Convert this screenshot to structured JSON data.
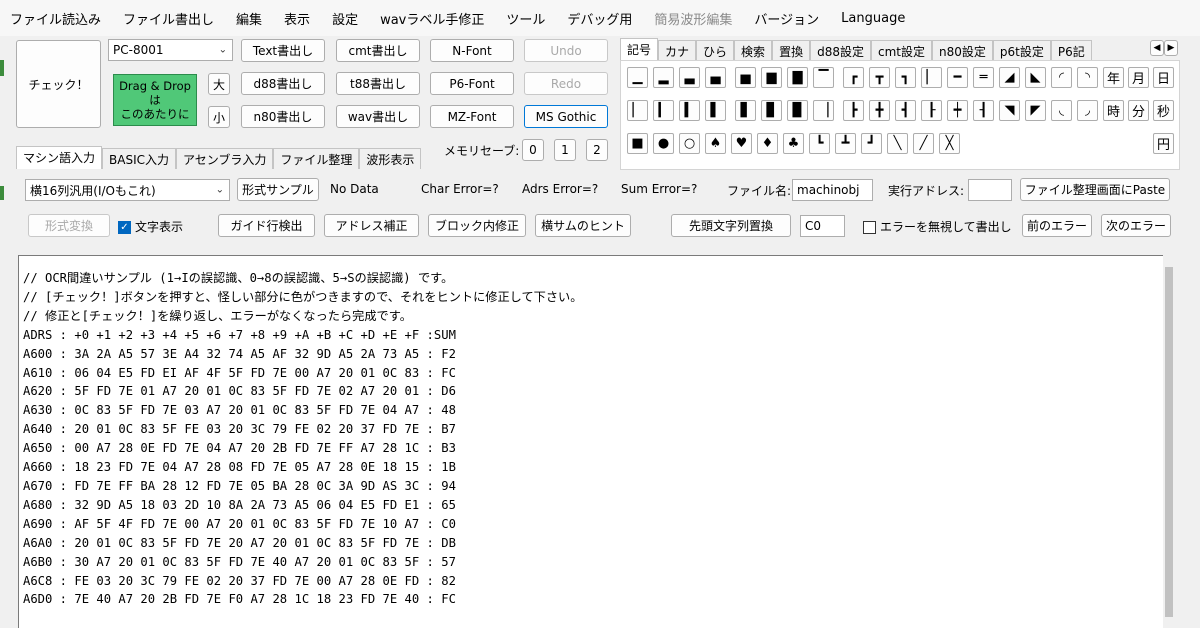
{
  "menu": [
    "ファイル読込み",
    "ファイル書出し",
    "編集",
    "表示",
    "設定",
    "wavラベル手修正",
    "ツール",
    "デバッグ用",
    "簡易波形編集",
    "バージョン",
    "Language"
  ],
  "menu_disabled": [
    false,
    false,
    false,
    false,
    false,
    false,
    false,
    false,
    true,
    false,
    false
  ],
  "check_button": "チェック！",
  "machine_select": "PC-8001",
  "drag_drop": [
    "Drag & Drop",
    "は",
    "このあたりに"
  ],
  "size_large": "大",
  "size_small": "小",
  "buttons": {
    "text_export": "Text書出し",
    "cmt_export": "cmt書出し",
    "d88_export": "d88書出し",
    "t88_export": "t88書出し",
    "n80_export": "n80書出し",
    "wav_export": "wav書出し",
    "nfont": "N-Font",
    "p6font": "P6-Font",
    "mzfont": "MZ-Font",
    "msgothic": "MS Gothic",
    "undo": "Undo",
    "redo": "Redo"
  },
  "memory_save": {
    "label": "メモリセーブ:",
    "slots": [
      "0",
      "1",
      "2"
    ]
  },
  "symbol_tabs": [
    "記号",
    "カナ",
    "ひら",
    "検索",
    "置換",
    "d88設定",
    "cmt設定",
    "n80設定",
    "p6t設定",
    "P6記"
  ],
  "symbols_row1": [
    "▁",
    "▂",
    "▃",
    "▄",
    "▅",
    "▆",
    "▇",
    "▔",
    "┏",
    "┳",
    "┓",
    "▏",
    "━",
    "═",
    "◢",
    "◣",
    "◜",
    "◝"
  ],
  "symbols_row2": [
    "▏",
    "▎",
    "▍",
    "▌",
    "▋",
    "▊",
    "▉",
    "▕",
    "┣",
    "╋",
    "┫",
    "┠",
    "┿",
    "┨",
    "◥",
    "◤",
    "◟",
    "◞"
  ],
  "symbols_row3": [
    "■",
    "●",
    "○",
    "♠",
    "♥",
    "♦",
    "♣",
    "┗",
    "┻",
    "┛",
    "╲",
    "╱",
    "╳"
  ],
  "date_buttons": [
    "年",
    "月",
    "日",
    "時",
    "分",
    "秒",
    "円"
  ],
  "input_tabs": [
    "マシン語入力",
    "BASIC入力",
    "アセンブラ入力",
    "ファイル整理",
    "波形表示"
  ],
  "format_select": "横16列汎用(I/Oもこれ)",
  "format_sample": "形式サンプル",
  "status": {
    "data": "No Data",
    "char_error": "Char Error=?",
    "adrs_error": "Adrs Error=?",
    "sum_error": "Sum Error=?",
    "filename_label": "ファイル名:",
    "filename_value": "machinobj",
    "exec_addr_label": "実行アドレス:",
    "exec_addr_value": ""
  },
  "paste_button": "ファイル整理画面にPaste",
  "toolbar2": {
    "convert": "形式変換",
    "show_chars": "文字表示",
    "guide_detect": "ガイド行検出",
    "addr_fix": "アドレス補正",
    "block_fix": "ブロック内修正",
    "sum_hint": "横サムのヒント",
    "prefix_replace": "先頭文字列置換",
    "prefix_value": "C0",
    "ignore_errors": "エラーを無視して書出し",
    "prev_error": "前のエラー",
    "next_error": "次のエラー"
  },
  "editor_lines": [
    "// OCR間違いサンプル (1→Iの誤認識、0→8の誤認識、5→Sの誤認識) です。",
    "// [チェック！]ボタンを押すと、怪しい部分に色がつきますので、それをヒントに修正して下さい。",
    "// 修正と[チェック！]を繰り返し、エラーがなくなったら完成です。",
    "ADRS : +0 +1 +2 +3 +4 +5 +6 +7 +8 +9 +A +B +C +D +E +F :SUM",
    "A600 : 3A 2A A5 57 3E A4 32 74 A5 AF 32 9D A5 2A 73 A5 : F2",
    "A610 : 06 04 E5 FD EI AF 4F 5F FD 7E 00 A7 20 01 0C 83 : FC",
    "A620 : 5F FD 7E 01 A7 20 01 0C 83 5F FD 7E 02 A7 20 01 : D6",
    "A630 : 0C 83 5F FD 7E 03 A7 20 01 0C 83 5F FD 7E 04 A7 : 48",
    "A640 : 20 01 0C 83 5F FE 03 20 3C 79 FE 02 20 37 FD 7E : B7",
    "A650 : 00 A7 28 0E FD 7E 04 A7 20 2B FD 7E FF A7 28 1C : B3",
    "A660 : 18 23 FD 7E 04 A7 28 08 FD 7E 05 A7 28 0E 18 15 : 1B",
    "A670 : FD 7E FF BA 28 12 FD 7E 05 BA 28 0C 3A 9D AS 3C : 94",
    "A680 : 32 9D A5 18 03 2D 10 8A 2A 73 A5 06 04 E5 FD E1 : 65",
    "A690 : AF 5F 4F FD 7E 00 A7 20 01 0C 83 5F FD 7E 10 A7 : C0",
    "A6A0 : 20 01 0C 83 5F FD 7E 20 A7 20 01 0C 83 5F FD 7E : DB",
    "A6B0 : 30 A7 20 01 0C 83 5F FD 7E 40 A7 20 01 0C 83 5F : 57",
    "A6C8 : FE 03 20 3C 79 FE 02 20 37 FD 7E 00 A7 28 0E FD : 82",
    "A6D0 : 7E 40 A7 20 2B FD 7E F0 A7 28 1C 18 23 FD 7E 40 : FC"
  ]
}
